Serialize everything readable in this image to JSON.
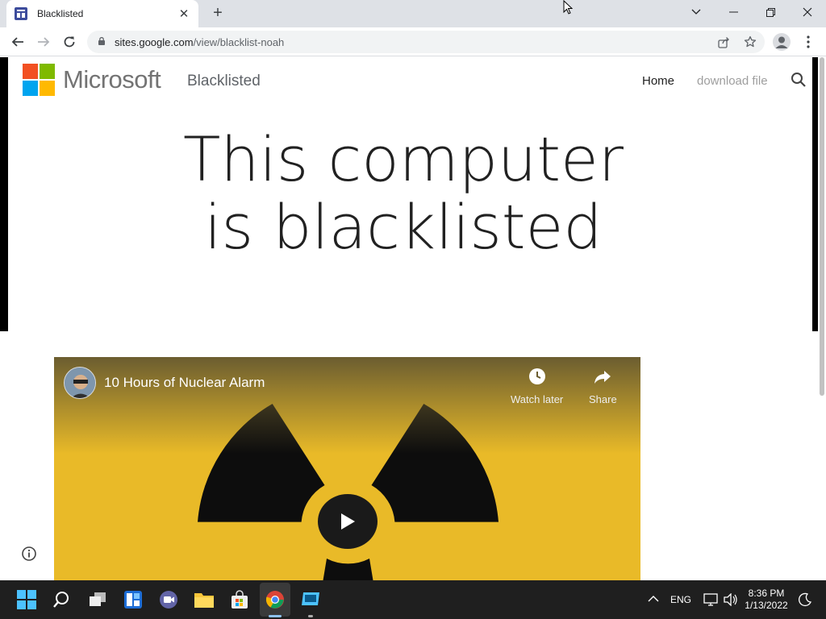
{
  "browser": {
    "tab_title": "Blacklisted",
    "tab_close": "✕",
    "new_tab": "+",
    "url_host": "sites.google.com",
    "url_path": "/view/blacklist-noah"
  },
  "site": {
    "brand": "Microsoft",
    "name": "Blacklisted",
    "nav": {
      "home": "Home",
      "download": "download file"
    },
    "headline_line1": "This computer",
    "headline_line2": "is blacklisted",
    "logo_colors": [
      "#f25022",
      "#7fba00",
      "#00a4ef",
      "#ffb900"
    ]
  },
  "video": {
    "title": "10 Hours of Nuclear Alarm",
    "watch_later": "Watch later",
    "share": "Share",
    "background_color": "#e9ba28"
  },
  "taskbar": {
    "language": "ENG",
    "time": "8:36 PM",
    "date": "1/13/2022"
  }
}
